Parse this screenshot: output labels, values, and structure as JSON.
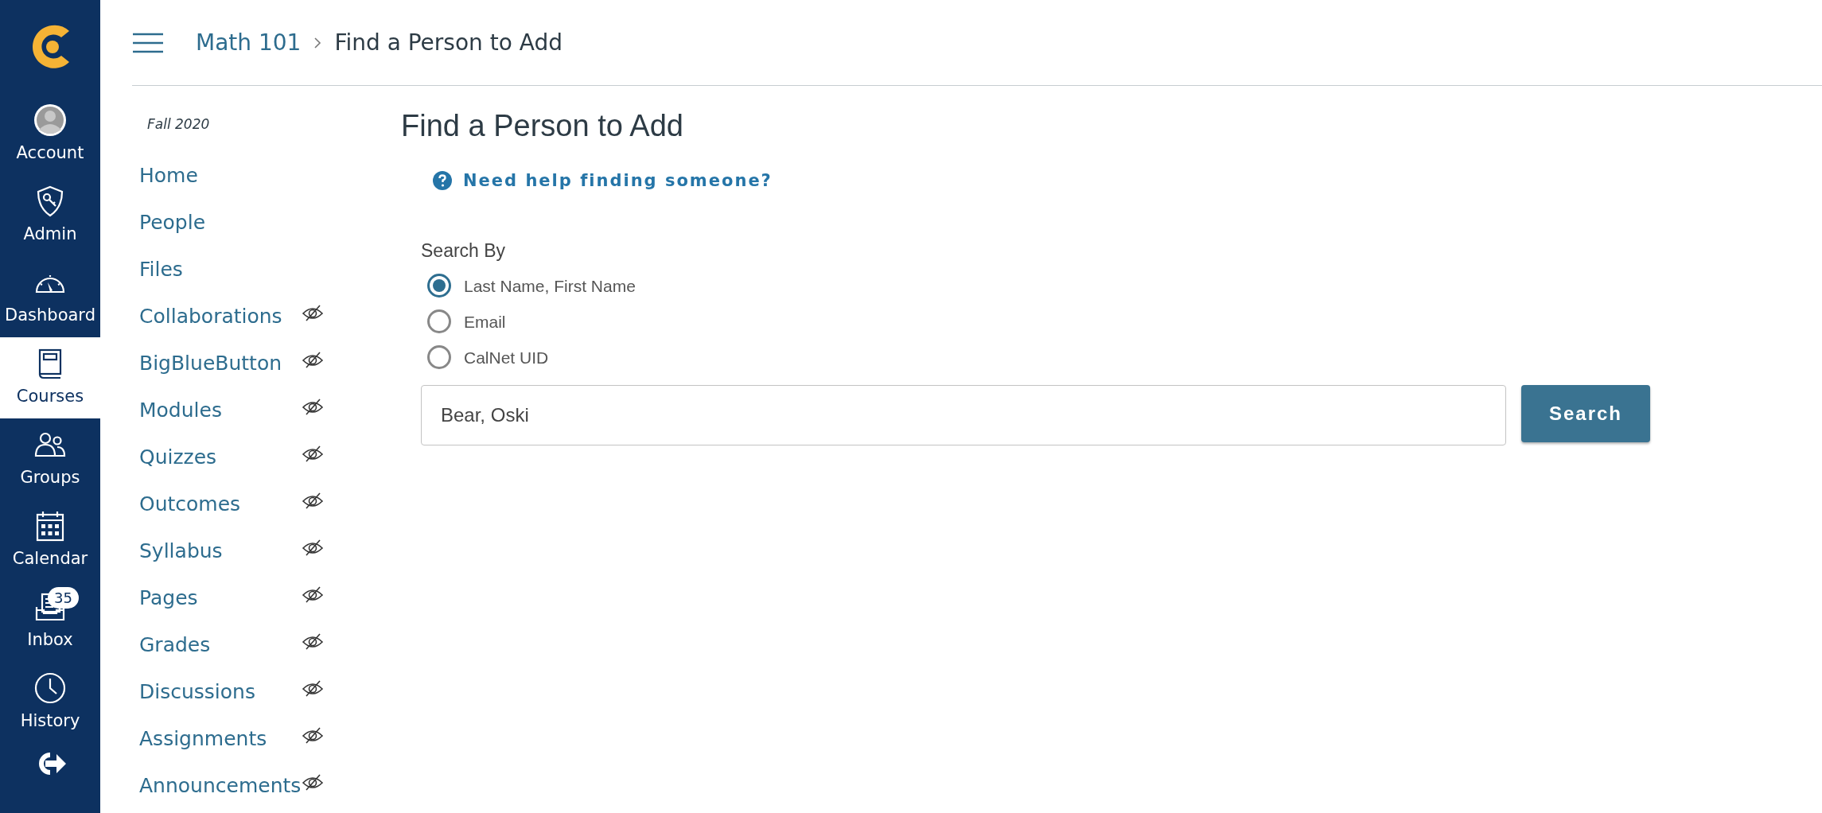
{
  "global_nav": [
    {
      "label": "Account",
      "selected": false
    },
    {
      "label": "Admin",
      "selected": false
    },
    {
      "label": "Dashboard",
      "selected": false
    },
    {
      "label": "Courses",
      "selected": true
    },
    {
      "label": "Groups",
      "selected": false
    },
    {
      "label": "Calendar",
      "selected": false
    },
    {
      "label": "Inbox",
      "selected": false,
      "badge": "35"
    },
    {
      "label": "History",
      "selected": false
    }
  ],
  "breadcrumb": [
    "Math 101",
    "Find a Person to Add"
  ],
  "term": "Fall 2020",
  "course_nav": [
    {
      "label": "Home",
      "hidden": false
    },
    {
      "label": "People",
      "hidden": false
    },
    {
      "label": "Files",
      "hidden": false
    },
    {
      "label": "Collaborations",
      "hidden": true
    },
    {
      "label": "BigBlueButton",
      "hidden": true
    },
    {
      "label": "Modules",
      "hidden": true
    },
    {
      "label": "Quizzes",
      "hidden": true
    },
    {
      "label": "Outcomes",
      "hidden": true
    },
    {
      "label": "Syllabus",
      "hidden": true
    },
    {
      "label": "Pages",
      "hidden": true
    },
    {
      "label": "Grades",
      "hidden": true
    },
    {
      "label": "Discussions",
      "hidden": true
    },
    {
      "label": "Assignments",
      "hidden": true
    },
    {
      "label": "Announcements",
      "hidden": true
    }
  ],
  "page_title": "Find a Person to Add",
  "help_link": "Need help finding someone?",
  "search_by": {
    "label": "Search By",
    "options": [
      {
        "label": "Last Name, First Name",
        "selected": true
      },
      {
        "label": "Email",
        "selected": false
      },
      {
        "label": "CalNet UID",
        "selected": false
      }
    ]
  },
  "search_field": {
    "value": "Bear, Oski"
  },
  "search_button": "Search"
}
